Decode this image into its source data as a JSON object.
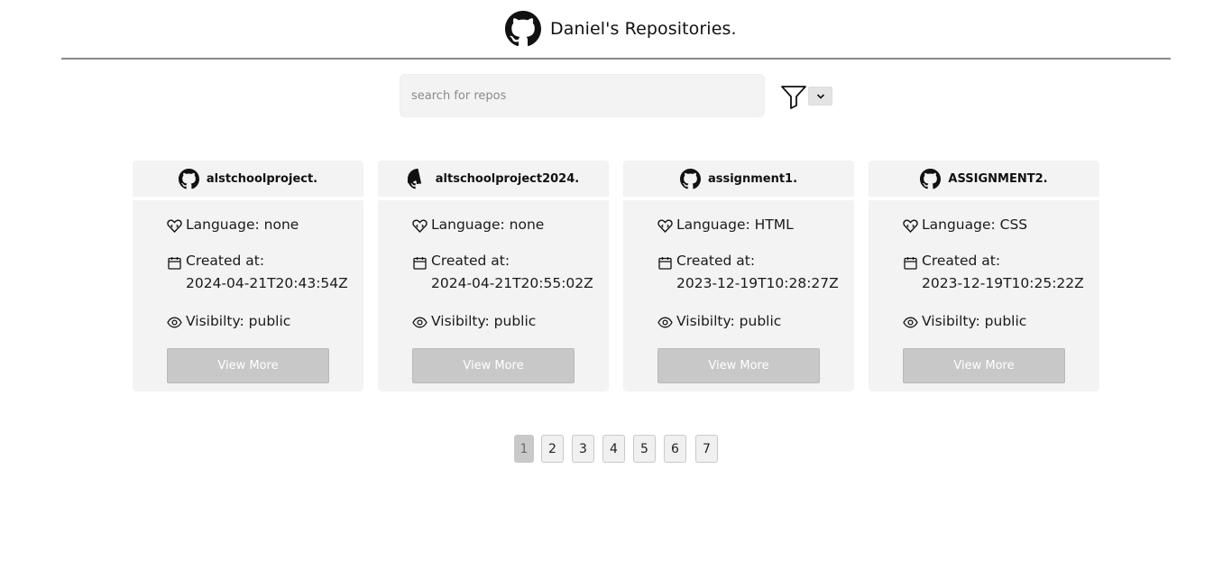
{
  "header": {
    "title": "Daniel's Repositories.",
    "logo_icon": "github-icon"
  },
  "search": {
    "placeholder": "search for repos",
    "value": "",
    "filter_icon": "filter-icon",
    "dropdown_icon": "chevron-down-icon"
  },
  "repos": [
    {
      "name": "alstchoolproject.",
      "language_label": "Language: none",
      "created_label": "Created at:",
      "created_value": "2024-04-21T20:43:54Z",
      "visibility_label": "Visibilty: public",
      "button_label": "View More"
    },
    {
      "name": "altschoolproject2024.",
      "language_label": "Language: none",
      "created_label": "Created at:",
      "created_value": "2024-04-21T20:55:02Z",
      "visibility_label": "Visibilty: public",
      "button_label": "View More"
    },
    {
      "name": "assignment1.",
      "language_label": "Language: HTML",
      "created_label": "Created at:",
      "created_value": "2023-12-19T10:28:27Z",
      "visibility_label": "Visibilty: public",
      "button_label": "View More"
    },
    {
      "name": "ASSIGNMENT2.",
      "language_label": "Language: CSS",
      "created_label": "Created at:",
      "created_value": "2023-12-19T10:25:22Z",
      "visibility_label": "Visibilty: public",
      "button_label": "View More"
    }
  ],
  "pagination": {
    "pages": [
      "1",
      "2",
      "3",
      "4",
      "5",
      "6",
      "7"
    ],
    "current": "1"
  },
  "colors": {
    "card_bg": "#f3f3f3",
    "button_bg": "#c8c8c8",
    "divider": "#8a8a8a"
  }
}
